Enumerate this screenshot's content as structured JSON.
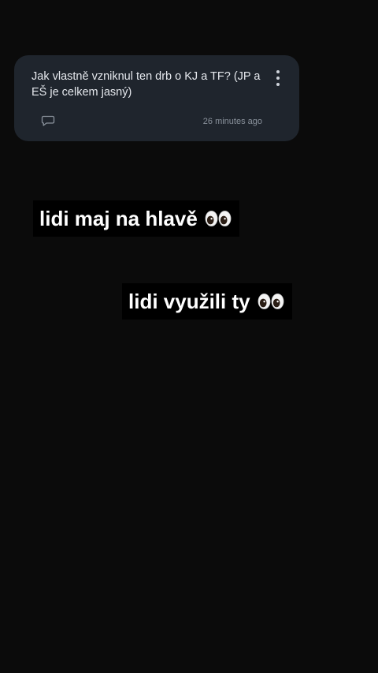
{
  "question_card": {
    "text": "Jak vlastně vzniknul ten drb o KJ a TF? (JP a EŠ je celkem jasný)",
    "timestamp": "26 minutes ago",
    "icons": {
      "comment": "comment-bubble-icon",
      "menu": "more-vertical-icon"
    }
  },
  "stickers": [
    {
      "text": "lidi maj na hlavě",
      "emoji": "eyes-emoji"
    },
    {
      "text": "lidi využili ty",
      "emoji": "eyes-emoji"
    }
  ],
  "colors": {
    "background": "#0b0b0b",
    "card": "#1f252d",
    "card_text": "#e6e9ee",
    "muted": "#8a929c",
    "sticker_bg": "#000000",
    "sticker_text": "#ffffff"
  }
}
